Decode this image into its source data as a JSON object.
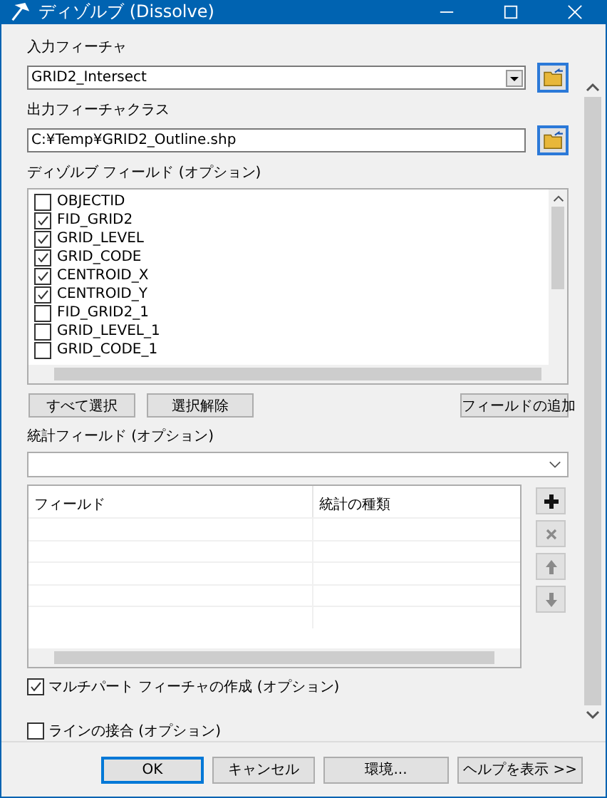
{
  "window": {
    "title": "ディゾルブ (Dissolve)"
  },
  "input_features": {
    "label": "入力フィーチャ",
    "value": "GRID2_Intersect"
  },
  "output_feature_class": {
    "label": "出力フィーチャクラス",
    "value": "C:¥Temp¥GRID2_Outline.shp"
  },
  "dissolve_fields": {
    "label": "ディゾルブ フィールド (オプション)",
    "items": [
      {
        "name": "OBJECTID",
        "checked": false
      },
      {
        "name": "FID_GRID2",
        "checked": true
      },
      {
        "name": "GRID_LEVEL",
        "checked": true
      },
      {
        "name": "GRID_CODE",
        "checked": true
      },
      {
        "name": "CENTROID_X",
        "checked": true
      },
      {
        "name": "CENTROID_Y",
        "checked": true
      },
      {
        "name": "FID_GRID2_1",
        "checked": false
      },
      {
        "name": "GRID_LEVEL_1",
        "checked": false
      },
      {
        "name": "GRID_CODE_1",
        "checked": false
      }
    ],
    "buttons": [
      "すべて選択",
      "選択解除"
    ],
    "add_field_button": "フィールドの追加"
  },
  "statistics_fields": {
    "label": "統計フィールド (オプション)",
    "columns": [
      "フィールド",
      "統計の種類"
    ],
    "tools": [
      {
        "kind": "add",
        "disabled": false
      },
      {
        "kind": "remove",
        "disabled": true
      },
      {
        "kind": "up",
        "disabled": true
      },
      {
        "kind": "down",
        "disabled": true
      }
    ]
  },
  "multipart": {
    "label": "マルチパート フィーチャの作成 (オプション)",
    "checked": true
  },
  "unsplit_lines": {
    "label": "ラインの接合 (オプション)",
    "checked": false
  },
  "buttons": [
    {
      "label": "OK",
      "default": true
    },
    {
      "label": "キャンセル",
      "default": false
    },
    {
      "label": "環境...",
      "default": false
    },
    {
      "label": "ヘルプを表示 >>",
      "default": false
    }
  ]
}
